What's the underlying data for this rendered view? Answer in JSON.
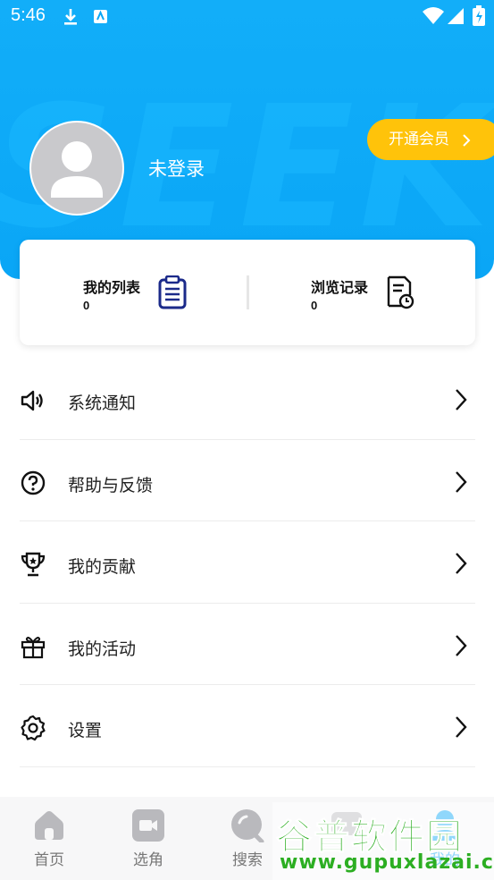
{
  "status_bar": {
    "time": "5:46"
  },
  "header": {
    "watermark_text": "SEEKER",
    "username": "未登录",
    "vip_button_label": "开通会员"
  },
  "stats": {
    "my_list": {
      "label": "我的列表",
      "count": "0"
    },
    "history": {
      "label": "浏览记录",
      "count": "0"
    }
  },
  "menu": [
    {
      "label": "系统通知",
      "icon": "speaker-icon"
    },
    {
      "label": "帮助与反馈",
      "icon": "help-icon"
    },
    {
      "label": "我的贡献",
      "icon": "trophy-icon"
    },
    {
      "label": "我的活动",
      "icon": "gift-icon"
    },
    {
      "label": "设置",
      "icon": "gear-icon"
    }
  ],
  "tabs": [
    {
      "label": "首页",
      "icon": "home-icon"
    },
    {
      "label": "选角",
      "icon": "video-icon"
    },
    {
      "label": "搜索",
      "icon": "search-icon"
    },
    {
      "label": "",
      "icon": "message-icon"
    },
    {
      "label": "我的",
      "icon": "profile-icon"
    }
  ],
  "watermark": {
    "brand": "谷普软件园",
    "url": "www.gupuxlazai.com"
  },
  "colors": {
    "header_blue": "#0aa6f6",
    "vip_yellow": "#ffc30a",
    "icon_navy": "#1b2a8a"
  }
}
